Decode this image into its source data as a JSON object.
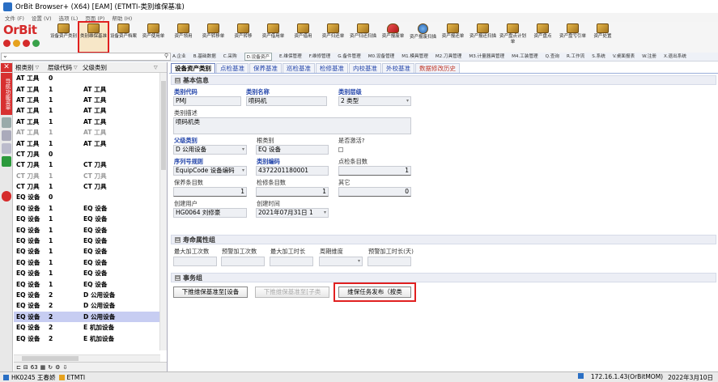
{
  "window": {
    "title": "OrBit Browser+ (X64) [EAM] (ETMTI-类别维保基准)"
  },
  "menu": [
    "文件 (F)",
    "设置 (V)",
    "选项 (L)",
    "页面 (P)",
    "帮助 (H)"
  ],
  "logo": {
    "brand": "OrBit"
  },
  "toolbar": [
    {
      "label": "设备资产类别",
      "icon": "folder-icon",
      "active": false
    },
    {
      "label": "类别维保基准",
      "icon": "folder-icon",
      "active": true
    },
    {
      "label": "设备资产档案",
      "icon": "folder-icon",
      "active": false
    },
    {
      "label": "资产使用单",
      "icon": "folder-icon",
      "active": false
    },
    {
      "label": "资产领用",
      "icon": "folder-icon",
      "active": false
    },
    {
      "label": "资产转移单",
      "icon": "folder-icon",
      "active": false
    },
    {
      "label": "资产转移",
      "icon": "folder-icon",
      "active": false
    },
    {
      "label": "资产借用单",
      "icon": "folder-icon",
      "active": false
    },
    {
      "label": "资产借用",
      "icon": "folder-icon",
      "active": false
    },
    {
      "label": "资产归还单",
      "icon": "folder-icon",
      "active": false
    },
    {
      "label": "资产归还扫描",
      "icon": "folder-icon",
      "active": false
    },
    {
      "label": "资产报废单",
      "icon": "shield-icon",
      "active": false
    },
    {
      "label": "资产报废扫描",
      "icon": "globe-icon",
      "active": false
    },
    {
      "label": "资产报还单",
      "icon": "folder-icon",
      "active": false
    },
    {
      "label": "资产报还扫描",
      "icon": "folder-icon",
      "active": false
    },
    {
      "label": "资产盘点计划单",
      "icon": "folder-icon",
      "active": false
    },
    {
      "label": "资产盘点",
      "icon": "folder-icon",
      "active": false
    },
    {
      "label": "资产盘亏引单",
      "icon": "folder-icon",
      "active": false
    },
    {
      "label": "资产处置",
      "icon": "folder-icon",
      "active": false
    }
  ],
  "module_tabs": [
    "A.企业",
    "B.基础数据",
    "C.采购",
    "D.设备资产",
    "E.维保管理",
    "F.维修管理",
    "G.备件管理",
    "M0.设备管理",
    "M1.模具管理",
    "M2.刀具管理",
    "M3.计量器具管理",
    "M4.工装管理",
    "Q.查询",
    "R.工作流",
    "S.系统",
    "V.桌面报表",
    "W.注册",
    "X.退出系统"
  ],
  "module_tab_selected": 3,
  "sidebar": {
    "close": "✕",
    "vertical_tab": "导航功能菜单"
  },
  "tree": {
    "columns": [
      "根类别",
      "层级代码",
      "父级类别"
    ],
    "rows": [
      {
        "root": "AT 工具",
        "level": "0",
        "parent": "",
        "dim": false
      },
      {
        "root": "AT 工具",
        "level": "1",
        "parent": "AT 工具",
        "dim": false
      },
      {
        "root": "AT 工具",
        "level": "1",
        "parent": "AT 工具",
        "dim": false
      },
      {
        "root": "AT 工具",
        "level": "1",
        "parent": "AT 工具",
        "dim": false
      },
      {
        "root": "AT 工具",
        "level": "1",
        "parent": "AT 工具",
        "dim": false
      },
      {
        "root": "AT 工具",
        "level": "1",
        "parent": "AT 工具",
        "dim": true
      },
      {
        "root": "AT 工具",
        "level": "1",
        "parent": "AT 工具",
        "dim": false
      },
      {
        "root": "CT 刀具",
        "level": "0",
        "parent": "",
        "dim": false
      },
      {
        "root": "CT 刀具",
        "level": "1",
        "parent": "CT 刀具",
        "dim": false
      },
      {
        "root": "CT 刀具",
        "level": "1",
        "parent": "CT 刀具",
        "dim": true
      },
      {
        "root": "CT 刀具",
        "level": "1",
        "parent": "CT 刀具",
        "dim": false
      },
      {
        "root": "EQ 设备",
        "level": "0",
        "parent": "",
        "dim": false
      },
      {
        "root": "EQ 设备",
        "level": "1",
        "parent": "EQ 设备",
        "dim": false
      },
      {
        "root": "EQ 设备",
        "level": "1",
        "parent": "EQ 设备",
        "dim": false
      },
      {
        "root": "EQ 设备",
        "level": "1",
        "parent": "EQ 设备",
        "dim": false
      },
      {
        "root": "EQ 设备",
        "level": "1",
        "parent": "EQ 设备",
        "dim": false
      },
      {
        "root": "EQ 设备",
        "level": "1",
        "parent": "EQ 设备",
        "dim": false
      },
      {
        "root": "EQ 设备",
        "level": "1",
        "parent": "EQ 设备",
        "dim": false
      },
      {
        "root": "EQ 设备",
        "level": "1",
        "parent": "EQ 设备",
        "dim": false
      },
      {
        "root": "EQ 设备",
        "level": "1",
        "parent": "EQ 设备",
        "dim": false
      },
      {
        "root": "EQ 设备",
        "level": "2",
        "parent": "D 公用设备",
        "dim": false
      },
      {
        "root": "EQ 设备",
        "level": "2",
        "parent": "D 公用设备",
        "dim": false
      },
      {
        "root": "EQ 设备",
        "level": "2",
        "parent": "D 公用设备",
        "dim": false,
        "selected": true
      },
      {
        "root": "EQ 设备",
        "level": "2",
        "parent": "E 机加设备",
        "dim": false
      },
      {
        "root": "EQ 设备",
        "level": "2",
        "parent": "E 机加设备",
        "dim": false
      }
    ],
    "footer_count": "63"
  },
  "content_tabs": [
    {
      "label": "设备资产类别",
      "selected": true,
      "red": false
    },
    {
      "label": "点检基准",
      "selected": false,
      "red": false
    },
    {
      "label": "保养基准",
      "selected": false,
      "red": false
    },
    {
      "label": "巡检基准",
      "selected": false,
      "red": false
    },
    {
      "label": "检修基准",
      "selected": false,
      "red": false
    },
    {
      "label": "内校基准",
      "selected": false,
      "red": false
    },
    {
      "label": "外校基准",
      "selected": false,
      "red": false
    },
    {
      "label": "数据修改历史",
      "selected": false,
      "red": true
    }
  ],
  "basic": {
    "title": "基本信息",
    "code_label": "类别代码",
    "code": "PMJ",
    "name_label": "类别名称",
    "name": "喷码机",
    "level_label": "类别层级",
    "level": "2 类型",
    "desc_label": "类别描述",
    "desc": "喷码机类",
    "parent_label": "父级类别",
    "parent": "D 公用设备",
    "root_label": "根类别",
    "root": "EQ 设备",
    "active_label": "是否激活?",
    "seq_label": "序列号规则",
    "seq": "EquipCode 设备编码",
    "catcode_label": "类别编码",
    "catcode": "4372201180001",
    "check_label": "点检条目数",
    "check": "1",
    "maint_label": "保养条目数",
    "maint": "1",
    "repair_label": "检修条目数",
    "repair": "1",
    "other_label": "其它",
    "other": "0",
    "creator_label": "创建用户",
    "creator": "HG0064 刘修豪",
    "ctime_label": "创建时间",
    "ctime": "2021年07月31日 1"
  },
  "life": {
    "title": "寿命属性组",
    "max_count": "最大加工次数",
    "warn_count": "预警加工次数",
    "max_time": "最大加工时长",
    "period": "周期维度",
    "warn_time": "预警加工时长(天)"
  },
  "events": {
    "title": "事务组",
    "btn1": "下推维保基准至[设备",
    "btn2": "下推维保基准至[子类",
    "btn3": "维保任务发布（按类"
  },
  "status": {
    "user": "HK0245 王春娇",
    "org": "ETMTI",
    "ip": "172.16.1.43(OrBitMOM)",
    "date": "2022年3月10日"
  },
  "colors": {
    "accent": "#d52b2b",
    "selected_row": "#c7cdf2",
    "highlight": "#e02020"
  }
}
